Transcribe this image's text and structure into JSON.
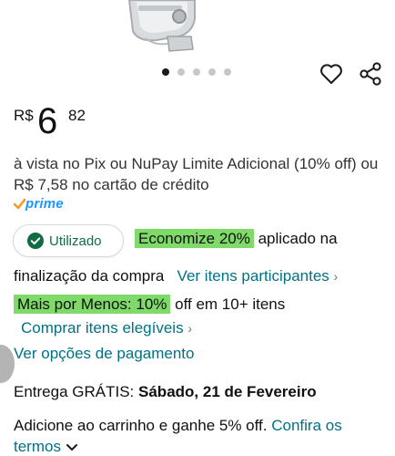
{
  "colors": {
    "link": "#007185",
    "highlight": "#7fda69",
    "prime_blue": "#1a98ff",
    "prime_check": "#f79a1f",
    "success_green": "#0f6d42"
  },
  "icons": {
    "wishlist": "heart-icon",
    "share": "share-icon",
    "used_check": "check-circle-icon",
    "prime_check": "check-icon",
    "expand": "chevron-down-icon"
  },
  "carousel": {
    "total": 5,
    "active_index": 0
  },
  "price": {
    "currency": "R$",
    "whole": "6",
    "fraction": "82"
  },
  "payment_text": "à vista no Pix ou NuPay Limite Adicional (10% off) ou R$ 7,58 no cartão de crédito",
  "prime": {
    "label": "prime"
  },
  "coupon": {
    "status_label": "Utilizado",
    "saving_label": "Economize 20%",
    "applied_text": "aplicado na",
    "checkout_text": "finalização da compra",
    "participating_link": "Ver itens participantes",
    "link_chevron": "›"
  },
  "offer": {
    "badge": "Mais por Menos: 10%",
    "text": "off em 10+ itens",
    "buy_link": "Comprar itens elegíveis",
    "link_chevron": "›"
  },
  "payment_options_link": "Ver opções de pagamento",
  "delivery": {
    "prefix": "Entrega GRÁTIS:",
    "date": "Sábado, 21 de Fevereiro"
  },
  "cart_offer": {
    "text": "Adicione ao carrinho e ganhe 5% off.",
    "link": "Confira os termos"
  }
}
